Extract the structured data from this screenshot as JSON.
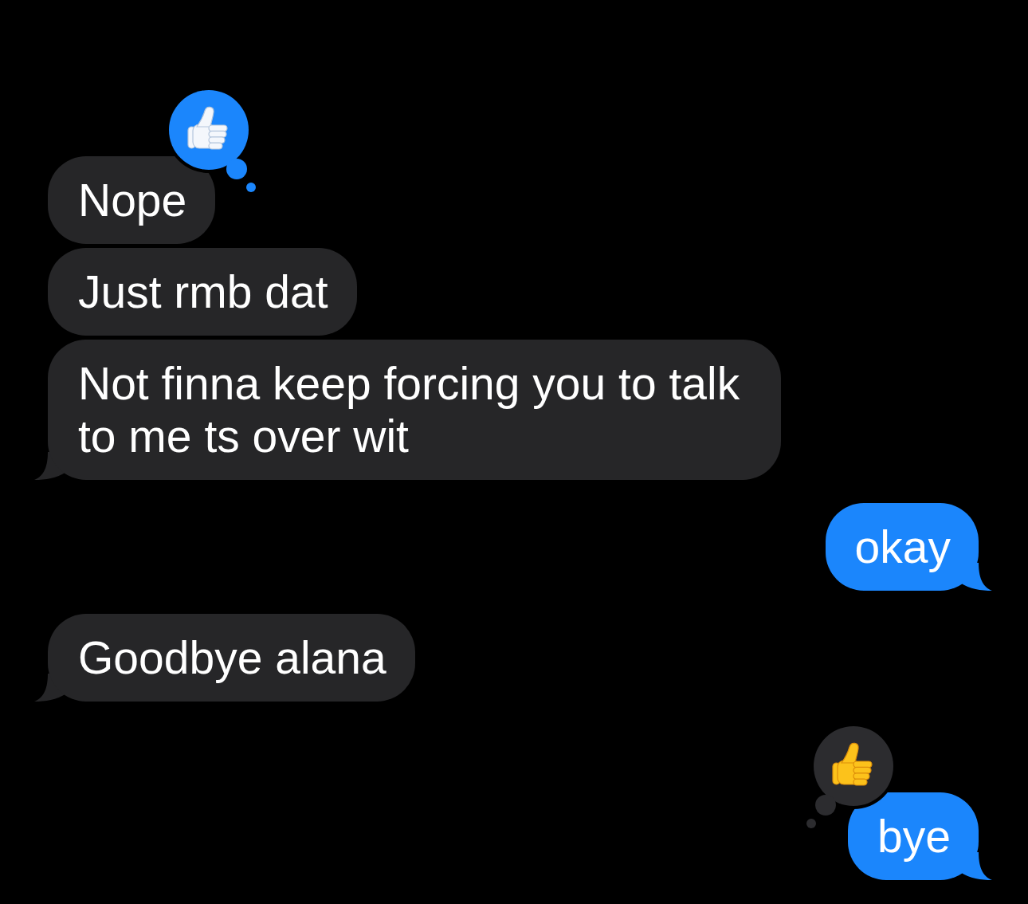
{
  "messages": [
    {
      "kind": "received",
      "text": "Nope",
      "reaction": {
        "kind": "thumbs_up",
        "from_me": true
      }
    },
    {
      "kind": "received",
      "text": "Just rmb dat"
    },
    {
      "kind": "received",
      "text": "Not finna keep forcing you to talk to me ts over wit"
    },
    {
      "kind": "sent",
      "text": "okay"
    },
    {
      "kind": "received",
      "text": "Goodbye alana"
    },
    {
      "kind": "sent",
      "text": "bye",
      "reaction": {
        "kind": "thumbs_up",
        "from_me": false
      }
    }
  ]
}
